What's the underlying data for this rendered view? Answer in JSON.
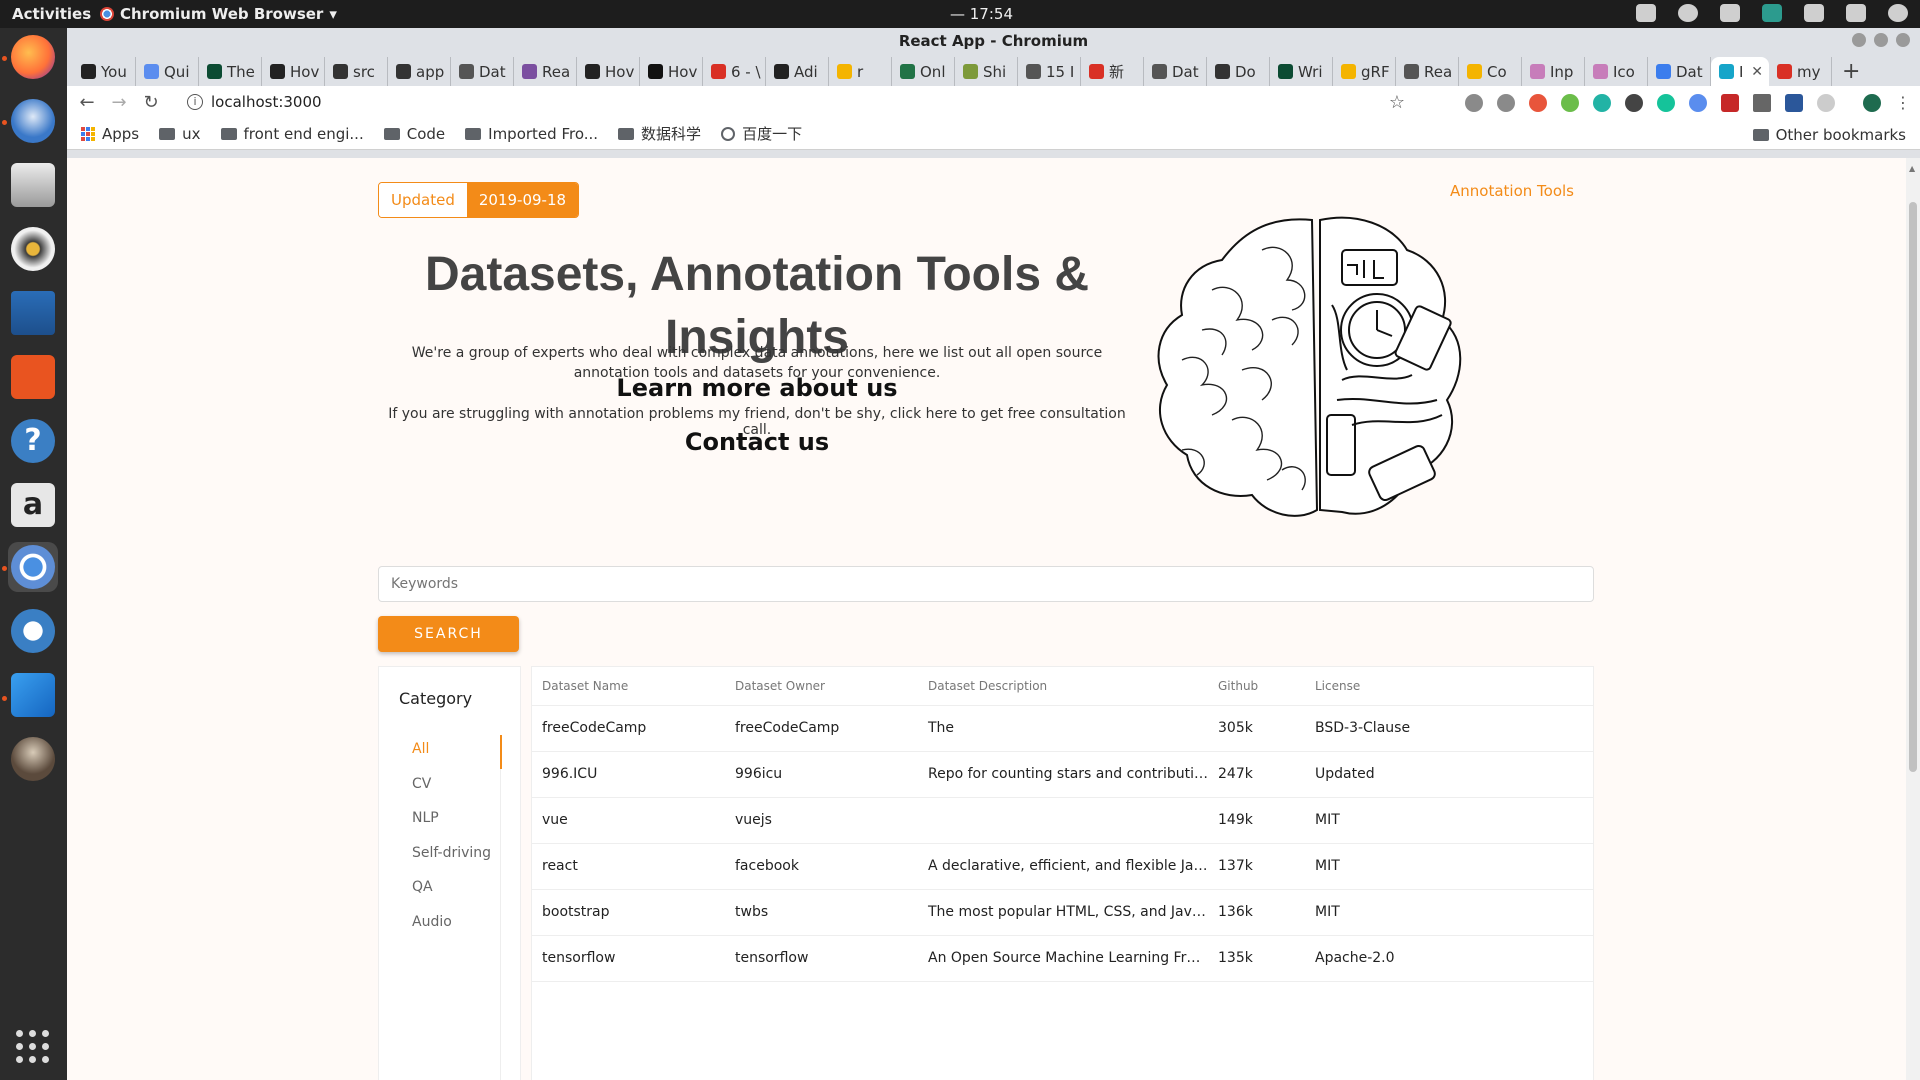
{
  "topbar": {
    "activities": "Activities",
    "app_name": "Chromium Web Browser",
    "clock": "— 17:54"
  },
  "window": {
    "title": "React App - Chromium"
  },
  "tabs": [
    {
      "label": "You",
      "color": "#222222"
    },
    {
      "label": "Qui",
      "color": "#5b8def"
    },
    {
      "label": "The",
      "color": "#0c4b33"
    },
    {
      "label": "Hov",
      "color": "#222222"
    },
    {
      "label": "src",
      "color": "#333333"
    },
    {
      "label": "app",
      "color": "#333333"
    },
    {
      "label": "Dat",
      "color": "#555555"
    },
    {
      "label": "Rea",
      "color": "#7b4fa0"
    },
    {
      "label": "Hov",
      "color": "#222222"
    },
    {
      "label": "Hov",
      "color": "#111111"
    },
    {
      "label": "6 - \\",
      "color": "#d93025"
    },
    {
      "label": "Adi",
      "color": "#222222"
    },
    {
      "label": "r",
      "color": "#f4b400"
    },
    {
      "label": "Onl",
      "color": "#217346"
    },
    {
      "label": "Shi",
      "color": "#7d9a3a"
    },
    {
      "label": "15 I",
      "color": "#555555"
    },
    {
      "label": "新",
      "color": "#d93025"
    },
    {
      "label": "Dat",
      "color": "#555555"
    },
    {
      "label": "Do",
      "color": "#333333"
    },
    {
      "label": "Wri",
      "color": "#0c4b33"
    },
    {
      "label": "gRF",
      "color": "#f4b400"
    },
    {
      "label": "Rea",
      "color": "#555555"
    },
    {
      "label": "Co",
      "color": "#f4b400"
    },
    {
      "label": "Inp",
      "color": "#c77dba"
    },
    {
      "label": "Ico",
      "color": "#c77dba"
    },
    {
      "label": "Dat",
      "color": "#3b7ded"
    },
    {
      "label": "I",
      "color": "#16a5c9",
      "active": true
    },
    {
      "label": "my",
      "color": "#d93025"
    }
  ],
  "toolbar": {
    "url": "localhost:3000"
  },
  "bookmarks": {
    "apps": "Apps",
    "items": [
      "ux",
      "front end engi...",
      "Code",
      "Imported Fro...",
      "数据科学",
      "百度一下"
    ],
    "other": "Other bookmarks"
  },
  "page": {
    "badge_key": "Updated",
    "badge_value": "2019-09-18",
    "top_link": "Annotation Tools",
    "title": "Datasets, Annotation Tools & Insights",
    "intro": "We're a group of experts who deal with complex data annotations, here we list out all open source annotation tools and datasets for your convenience.",
    "learn_more": "Learn more about us",
    "struggle": "If you are struggling with annotation problems my friend, don't be shy, click here to get free consultation call.",
    "contact": "Contact us",
    "search_placeholder": "Keywords",
    "search_button": "SEARCH",
    "accent_color": "#f38b18"
  },
  "category": {
    "title": "Category",
    "items": [
      "All",
      "CV",
      "NLP",
      "Self-driving",
      "QA",
      "Audio"
    ],
    "selected": "All"
  },
  "table": {
    "headers": [
      "Dataset Name",
      "Dataset Owner",
      "Dataset Description",
      "Github",
      "License"
    ],
    "rows": [
      [
        "freeCodeCamp",
        "freeCodeCamp",
        "The",
        "305k",
        "BSD-3-Clause"
      ],
      [
        "996.ICU",
        "996icu",
        "Repo for counting stars and contributing. Press F t...",
        "247k",
        "Updated"
      ],
      [
        "vue",
        "vuejs",
        "",
        "149k",
        "MIT"
      ],
      [
        "react",
        "facebook",
        "A declarative, efficient, and flexible JavaScript libr...",
        "137k",
        "MIT"
      ],
      [
        "bootstrap",
        "twbs",
        "The most popular HTML, CSS, and JavaScript fram...",
        "136k",
        "MIT"
      ],
      [
        "tensorflow",
        "tensorflow",
        "An Open Source Machine Learning Framework for ...",
        "135k",
        "Apache-2.0"
      ]
    ]
  }
}
